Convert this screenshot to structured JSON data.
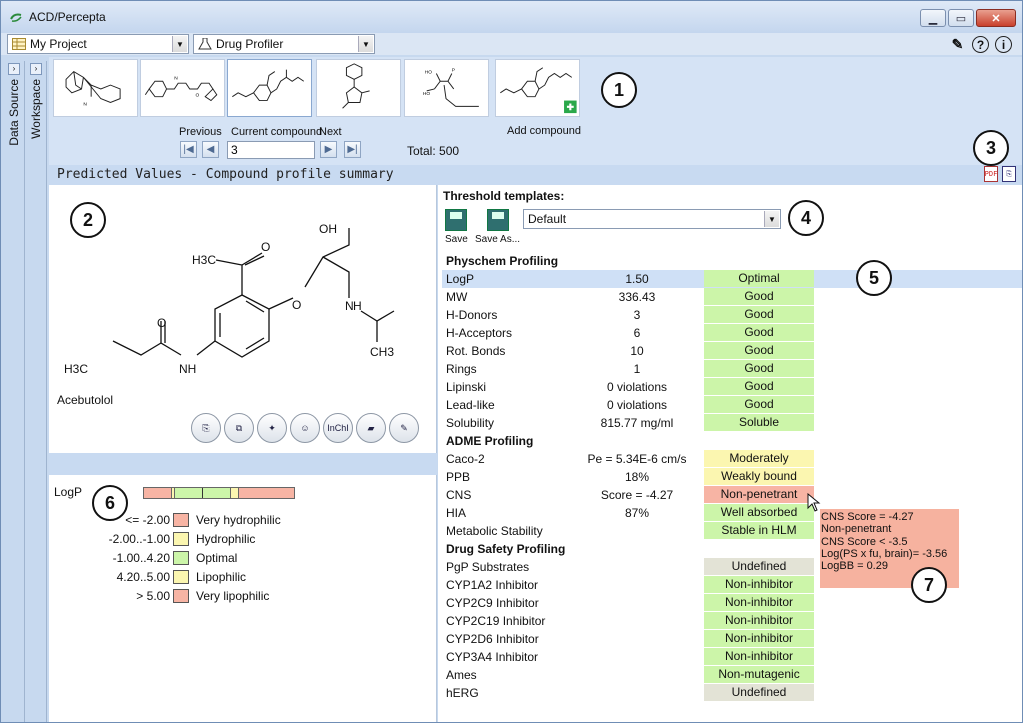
{
  "window": {
    "title": "ACD/Percepta"
  },
  "toolbar": {
    "project": "My Project",
    "module": "Drug Profiler"
  },
  "side_tabs": [
    "Data Source",
    "Workspace"
  ],
  "compound_nav": {
    "previous_label": "Previous",
    "current_label": "Current compound",
    "next_label": "Next",
    "current_value": "3",
    "total": "Total: 500",
    "add_label": "Add compound"
  },
  "section_title": "Predicted Values - Compound profile summary",
  "molecule": {
    "name": "Acebutolol",
    "atom_labels": [
      "H3C",
      "O",
      "OH",
      "O",
      "N",
      "H",
      "O",
      "NH",
      "H3C",
      "CH3"
    ]
  },
  "mol_buttons": [
    "InChI"
  ],
  "logp_legend": {
    "label": "LogP",
    "rows": [
      {
        "range": "<= -2.00",
        "label": "Very hydrophilic",
        "color": "#f7b4a4"
      },
      {
        "range": "-2.00..-1.00",
        "label": "Hydrophilic",
        "color": "#fbf6b0"
      },
      {
        "range": "-1.00..4.20",
        "label": "Optimal",
        "color": "#ccf5a9"
      },
      {
        "range": "4.20..5.00",
        "label": "Lipophilic",
        "color": "#fbf6b0"
      },
      {
        "range": "> 5.00",
        "label": "Very lipophilic",
        "color": "#f7b4a4"
      }
    ]
  },
  "templates": {
    "title": "Threshold templates:",
    "save": "Save",
    "save_as": "Save As...",
    "selected": "Default"
  },
  "groups": [
    {
      "title": "Physchem Profiling",
      "rows": [
        {
          "name": "LogP",
          "value": "1.50",
          "class": "Optimal",
          "color": "green",
          "selected": true
        },
        {
          "name": "MW",
          "value": "336.43",
          "class": "Good",
          "color": "green"
        },
        {
          "name": "H-Donors",
          "value": "3",
          "class": "Good",
          "color": "green"
        },
        {
          "name": "H-Acceptors",
          "value": "6",
          "class": "Good",
          "color": "green"
        },
        {
          "name": "Rot. Bonds",
          "value": "10",
          "class": "Good",
          "color": "green"
        },
        {
          "name": "Rings",
          "value": "1",
          "class": "Good",
          "color": "green"
        },
        {
          "name": "Lipinski",
          "value": "0 violations",
          "class": "Good",
          "color": "green"
        },
        {
          "name": "Lead-like",
          "value": "0 violations",
          "class": "Good",
          "color": "green"
        },
        {
          "name": "Solubility",
          "value": "815.77 mg/ml",
          "class": "Soluble",
          "color": "green"
        }
      ]
    },
    {
      "title": "ADME Profiling",
      "rows": [
        {
          "name": "Caco-2",
          "value": "Pe = 5.34E-6 cm/s",
          "class": "Moderately permeable",
          "color": "yellow"
        },
        {
          "name": "PPB",
          "value": "18%",
          "class": "Weakly bound",
          "color": "yellow"
        },
        {
          "name": "CNS",
          "value": "Score = -4.27",
          "class": "Non-penetrant",
          "color": "red"
        },
        {
          "name": "HIA",
          "value": "87%",
          "class": "Well absorbed",
          "color": "green"
        },
        {
          "name": "Metabolic Stability",
          "value": "",
          "class": "Stable in HLM",
          "color": "green"
        }
      ]
    },
    {
      "title": "Drug Safety Profiling",
      "rows": [
        {
          "name": "PgP Substrates",
          "value": "",
          "class": "Undefined",
          "color": "gray"
        },
        {
          "name": "CYP1A2 Inhibitor",
          "value": "",
          "class": "Non-inhibitor",
          "color": "green"
        },
        {
          "name": "CYP2C9 Inhibitor",
          "value": "",
          "class": "Non-inhibitor",
          "color": "green"
        },
        {
          "name": "CYP2C19 Inhibitor",
          "value": "",
          "class": "Non-inhibitor",
          "color": "green"
        },
        {
          "name": "CYP2D6 Inhibitor",
          "value": "",
          "class": "Non-inhibitor",
          "color": "green"
        },
        {
          "name": "CYP3A4 Inhibitor",
          "value": "",
          "class": "Non-inhibitor",
          "color": "green"
        },
        {
          "name": "Ames",
          "value": "",
          "class": "Non-mutagenic",
          "color": "green"
        },
        {
          "name": "hERG",
          "value": "",
          "class": "Undefined",
          "color": "gray"
        }
      ]
    }
  ],
  "tooltip": [
    "CNS Score = -4.27",
    "Non-penetrant",
    "CNS Score < -3.5",
    "Log(PS x fu, brain)= -3.56",
    "LogBB = 0.29"
  ],
  "callouts": [
    "1",
    "2",
    "3",
    "4",
    "5",
    "6",
    "7"
  ]
}
